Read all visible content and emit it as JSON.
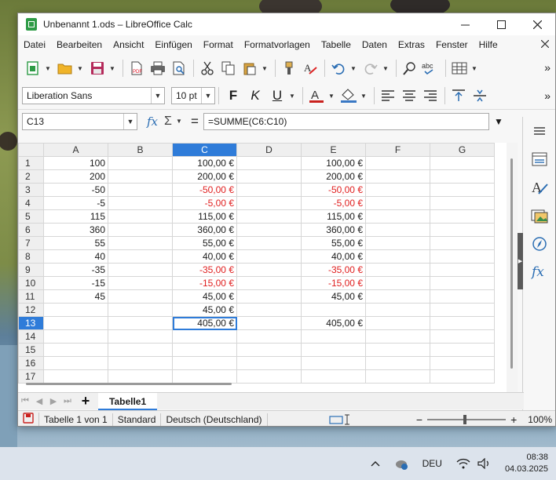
{
  "window": {
    "title": "Unbenannt 1.ods – LibreOffice Calc"
  },
  "menu": [
    "Datei",
    "Bearbeiten",
    "Ansicht",
    "Einfügen",
    "Format",
    "Formatvorlagen",
    "Tabelle",
    "Daten",
    "Extras",
    "Fenster",
    "Hilfe"
  ],
  "format": {
    "font_name": "Liberation Sans",
    "font_size": "10 pt",
    "bold": "F",
    "italic": "K",
    "underline": "U"
  },
  "formula_bar": {
    "cell_ref": "C13",
    "formula": "=SUMME(C6:C10)"
  },
  "grid": {
    "columns": [
      "A",
      "B",
      "C",
      "D",
      "E",
      "F",
      "G"
    ],
    "selected_column": "C",
    "selected_row": "13",
    "rows": [
      {
        "n": "1",
        "a": "100",
        "c": "100,00 €",
        "e": "100,00 €",
        "neg": false
      },
      {
        "n": "2",
        "a": "200",
        "c": "200,00 €",
        "e": "200,00 €",
        "neg": false
      },
      {
        "n": "3",
        "a": "-50",
        "c": "-50,00 €",
        "e": "-50,00 €",
        "neg": true
      },
      {
        "n": "4",
        "a": "-5",
        "c": "-5,00 €",
        "e": "-5,00 €",
        "neg": true
      },
      {
        "n": "5",
        "a": "115",
        "c": "115,00 €",
        "e": "115,00 €",
        "neg": false
      },
      {
        "n": "6",
        "a": "360",
        "c": "360,00 €",
        "e": "360,00 €",
        "neg": false
      },
      {
        "n": "7",
        "a": "55",
        "c": "55,00 €",
        "e": "55,00 €",
        "neg": false
      },
      {
        "n": "8",
        "a": "40",
        "c": "40,00 €",
        "e": "40,00 €",
        "neg": false
      },
      {
        "n": "9",
        "a": "-35",
        "c": "-35,00 €",
        "e": "-35,00 €",
        "neg": true
      },
      {
        "n": "10",
        "a": "-15",
        "c": "-15,00 €",
        "e": "-15,00 €",
        "neg": true
      },
      {
        "n": "11",
        "a": "45",
        "c": "45,00 €",
        "e": "45,00 €",
        "neg": false
      },
      {
        "n": "12",
        "a": "",
        "c": "45,00 €",
        "e": "",
        "neg": false
      },
      {
        "n": "13",
        "a": "",
        "c": "405,00 €",
        "e": "405,00 €",
        "neg": false
      },
      {
        "n": "14",
        "a": "",
        "c": "",
        "e": "",
        "neg": false
      },
      {
        "n": "15",
        "a": "",
        "c": "",
        "e": "",
        "neg": false
      },
      {
        "n": "16",
        "a": "",
        "c": "",
        "e": "",
        "neg": false
      },
      {
        "n": "17",
        "a": "",
        "c": "",
        "e": "",
        "neg": false
      }
    ]
  },
  "sheets": {
    "active": "Tabelle1",
    "add_icon": "+"
  },
  "status": {
    "sheet_info": "Tabelle 1 von 1",
    "style": "Standard",
    "language": "Deutsch (Deutschland)",
    "zoom": "100%",
    "zoom_minus": "−",
    "zoom_plus": "+"
  },
  "taskbar": {
    "language": "DEU",
    "time": "08:38",
    "date": "04.03.2025"
  },
  "colors": {
    "accent": "#2f7cd9",
    "negative": "#e02020",
    "calc_green": "#2e9b46"
  },
  "icons": [
    "new-spreadsheet-icon",
    "open-folder-icon",
    "save-icon",
    "export-pdf-icon",
    "print-icon",
    "print-preview-icon",
    "cut-icon",
    "copy-icon",
    "paste-icon",
    "clone-formatting-icon",
    "clear-formatting-icon",
    "undo-icon",
    "redo-icon",
    "find-replace-icon",
    "spelling-icon",
    "row-icon",
    "align-left-icon",
    "align-center-icon",
    "align-right-icon",
    "align-top-icon",
    "center-vertically-icon",
    "properties-icon",
    "styles-icon",
    "gallery-icon",
    "navigator-icon",
    "functions-icon",
    "menu-icon"
  ]
}
